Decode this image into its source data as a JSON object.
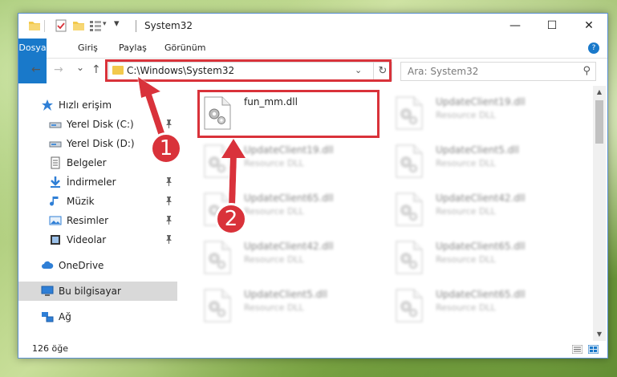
{
  "window": {
    "title": "System32",
    "minimize": "—",
    "maximize": "☐",
    "close": "✕"
  },
  "ribbon": {
    "tabs": [
      "Dosya",
      "Giriş",
      "Paylaş",
      "Görünüm"
    ],
    "collapse": "?"
  },
  "navigation": {
    "back": "←",
    "forward": "→",
    "recent": "⌄",
    "up": "↑",
    "address": "C:\\Windows\\System32",
    "search_placeholder": "Ara: System32"
  },
  "nav_pane": {
    "items": [
      {
        "label": "Hızlı erişim",
        "icon": "star-icon",
        "pinned": false,
        "selected": false
      },
      {
        "label": "Yerel Disk (C:)",
        "icon": "drive-icon",
        "pinned": true,
        "selected": false
      },
      {
        "label": "Yerel Disk (D:)",
        "icon": "drive-icon",
        "pinned": false,
        "selected": false
      },
      {
        "label": "Belgeler",
        "icon": "documents-icon",
        "pinned": false,
        "selected": false
      },
      {
        "label": "İndirmeler",
        "icon": "downloads-icon",
        "pinned": true,
        "selected": false
      },
      {
        "label": "Müzik",
        "icon": "music-icon",
        "pinned": true,
        "selected": false
      },
      {
        "label": "Resimler",
        "icon": "pictures-icon",
        "pinned": true,
        "selected": false
      },
      {
        "label": "Videolar",
        "icon": "videos-icon",
        "pinned": true,
        "selected": false
      },
      {
        "label": "OneDrive",
        "icon": "cloud-icon",
        "pinned": false,
        "selected": false
      },
      {
        "label": "Bu bilgisayar",
        "icon": "computer-icon",
        "pinned": false,
        "selected": true
      },
      {
        "label": "Ağ",
        "icon": "network-icon",
        "pinned": false,
        "selected": false
      }
    ]
  },
  "files": [
    {
      "name": "fun_mm.dll",
      "type": "",
      "blurred": false
    },
    {
      "name": "UpdateClient19.dll",
      "type": "Resource DLL",
      "blurred": true
    },
    {
      "name": "UpdateClient19.dll",
      "type": "Resource DLL",
      "blurred": true
    },
    {
      "name": "UpdateClient5.dll",
      "type": "Resource DLL",
      "blurred": true
    },
    {
      "name": "UpdateClient65.dll",
      "type": "Resource DLL",
      "blurred": true
    },
    {
      "name": "UpdateClient42.dll",
      "type": "Resource DLL",
      "blurred": true
    },
    {
      "name": "UpdateClient42.dll",
      "type": "Resource DLL",
      "blurred": true
    },
    {
      "name": "UpdateClient65.dll",
      "type": "Resource DLL",
      "blurred": true
    },
    {
      "name": "UpdateClient5.dll",
      "type": "Resource DLL",
      "blurred": true
    },
    {
      "name": "UpdateClient65.dll",
      "type": "Resource DLL",
      "blurred": true
    }
  ],
  "status": {
    "item_count": "126 öğe"
  },
  "annotations": {
    "step1": "1",
    "step2": "2",
    "color": "#d9323a"
  },
  "colors": {
    "accent": "#1979ca",
    "selection": "#d9d9d9"
  }
}
